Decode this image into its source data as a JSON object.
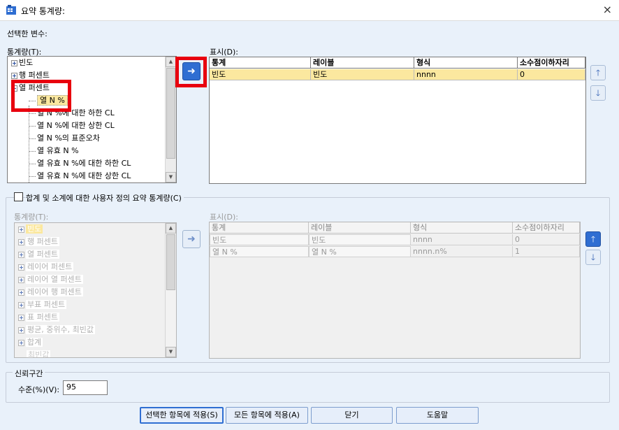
{
  "window": {
    "title": "요약 통계량:",
    "close": "×"
  },
  "selected_vars_label": "선택한 변수:",
  "top": {
    "stats_label": "통계량(T):",
    "display_label": "표시(D):",
    "tree": [
      {
        "label": "빈도",
        "type": "plus"
      },
      {
        "label": "행 퍼센트",
        "type": "plus"
      },
      {
        "label": "열 퍼센트",
        "type": "minus"
      },
      {
        "label": "열 N %",
        "type": "child",
        "selected": true
      },
      {
        "label": "열 N %에 대한 하한 CL",
        "type": "child"
      },
      {
        "label": "열 N %에 대한 상한 CL",
        "type": "child"
      },
      {
        "label": "열 N %의 표준오차",
        "type": "child"
      },
      {
        "label": "열 유효 N %",
        "type": "child"
      },
      {
        "label": "열 유효 N %에 대한 하한 CL",
        "type": "child"
      },
      {
        "label": "열 유효 N %에 대한 상한 CL",
        "type": "child"
      }
    ],
    "grid": {
      "headers": [
        "통계",
        "레이블",
        "형식",
        "소수점이하자리"
      ],
      "rows": [
        [
          "빈도",
          "빈도",
          "nnnn",
          "0"
        ]
      ]
    },
    "move_arrow": "➜",
    "up": "🡑",
    "down": "🡓"
  },
  "custom": {
    "checkbox_label": "합계 및 소계에 대한 사용자 정의 요약 통계량(C)",
    "stats_label": "통계량(T):",
    "display_label": "표시(D):",
    "tree": [
      {
        "label": "빈도",
        "highlight": true
      },
      {
        "label": "행 퍼센트"
      },
      {
        "label": "열 퍼센트"
      },
      {
        "label": "레이어 퍼센트"
      },
      {
        "label": "레이어 열 퍼센트"
      },
      {
        "label": "레이어 행 퍼센트"
      },
      {
        "label": "부표 퍼센트"
      },
      {
        "label": "표 퍼센트"
      },
      {
        "label": "평균, 중위수, 최빈값"
      },
      {
        "label": "합계"
      },
      {
        "label": "최빈값"
      }
    ],
    "grid": {
      "headers": [
        "통계",
        "레이블",
        "형식",
        "소수점이하자리"
      ],
      "rows": [
        [
          "빈도",
          "빈도",
          "nnnn",
          "0"
        ],
        [
          "열 N %",
          "열 N %",
          "nnnn.n%",
          "1"
        ]
      ]
    }
  },
  "ci": {
    "group_label": "신뢰구간",
    "level_label": "수준(%)(V):",
    "level_value": "95"
  },
  "buttons": {
    "apply_selected": "선택한 항목에 적용(S)",
    "apply_all": "모든 항목에 적용(A)",
    "close": "닫기",
    "help": "도움말"
  },
  "colors": {
    "background": "#e9f1fa",
    "selection": "#fbe89f",
    "highlight_red": "#e8000e",
    "accent": "#2f6ed2"
  }
}
